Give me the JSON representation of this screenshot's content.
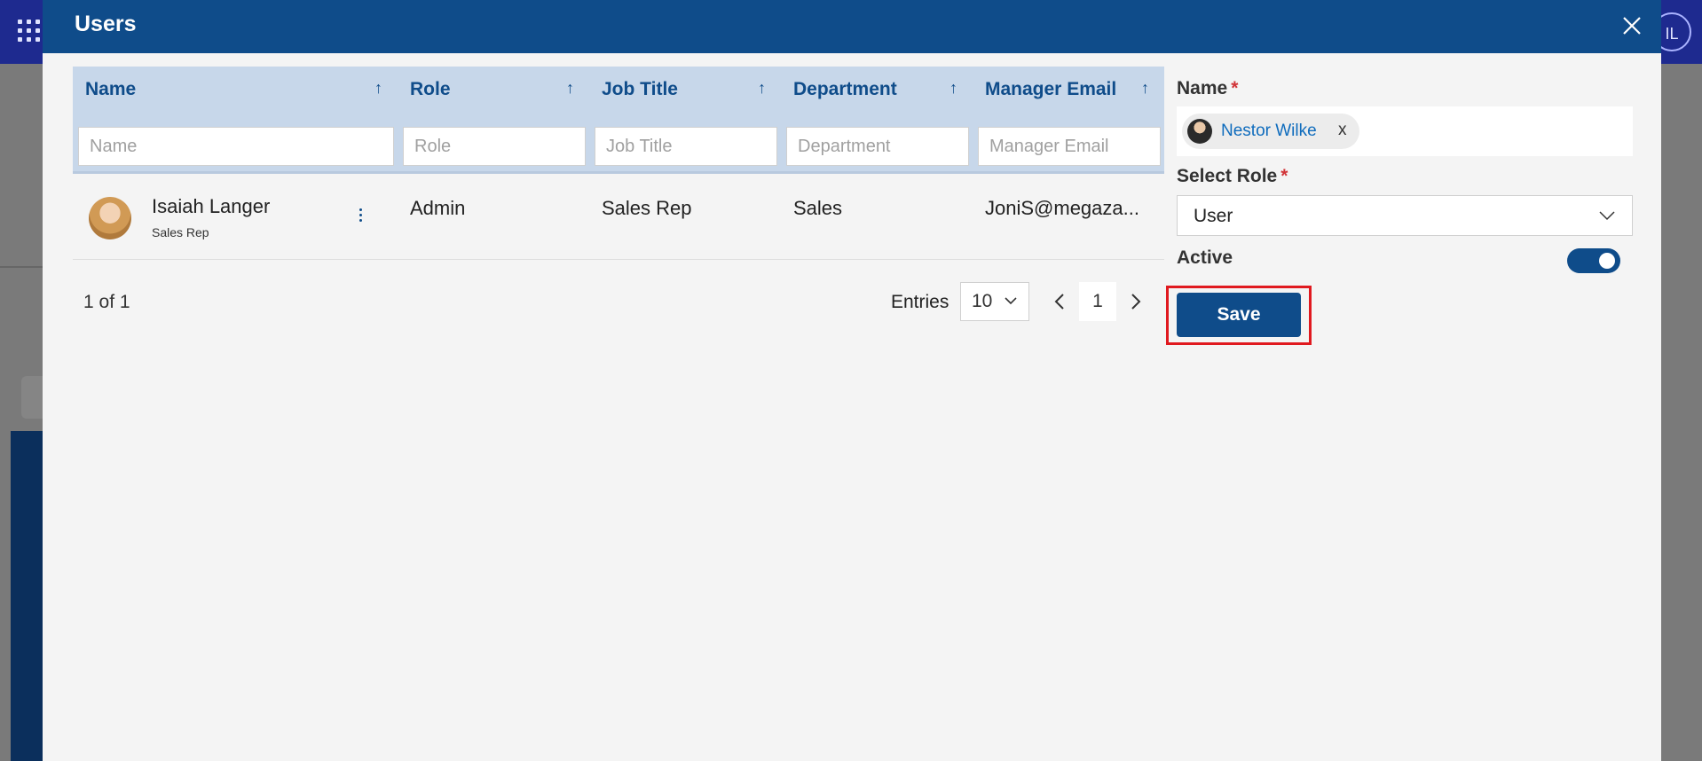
{
  "dialog": {
    "title": "Users"
  },
  "table": {
    "columns": [
      {
        "label": "Name",
        "placeholder": "Name"
      },
      {
        "label": "Role",
        "placeholder": "Role"
      },
      {
        "label": "Job Title",
        "placeholder": "Job Title"
      },
      {
        "label": "Department",
        "placeholder": "Department"
      },
      {
        "label": "Manager Email",
        "placeholder": "Manager Email"
      }
    ],
    "rows": [
      {
        "name": "Isaiah Langer",
        "subtitle": "Sales Rep",
        "role": "Admin",
        "job_title": "Sales Rep",
        "department": "Sales",
        "manager_email": "JoniS@megaza..."
      }
    ]
  },
  "pagination": {
    "info": "1 of 1",
    "entries_label": "Entries",
    "entries_value": "10",
    "page": "1"
  },
  "form": {
    "name_label": "Name",
    "required_mark": "*",
    "selected_person": "Nestor Wilke",
    "remove_label": "x",
    "role_label": "Select Role",
    "role_value": "User",
    "active_label": "Active",
    "active_on": true,
    "save_label": "Save"
  },
  "background": {
    "avatar_initials": "IL"
  },
  "colors": {
    "header": "#0f4c8a",
    "accent": "#0f4c8a",
    "highlight": "#e0191f"
  }
}
